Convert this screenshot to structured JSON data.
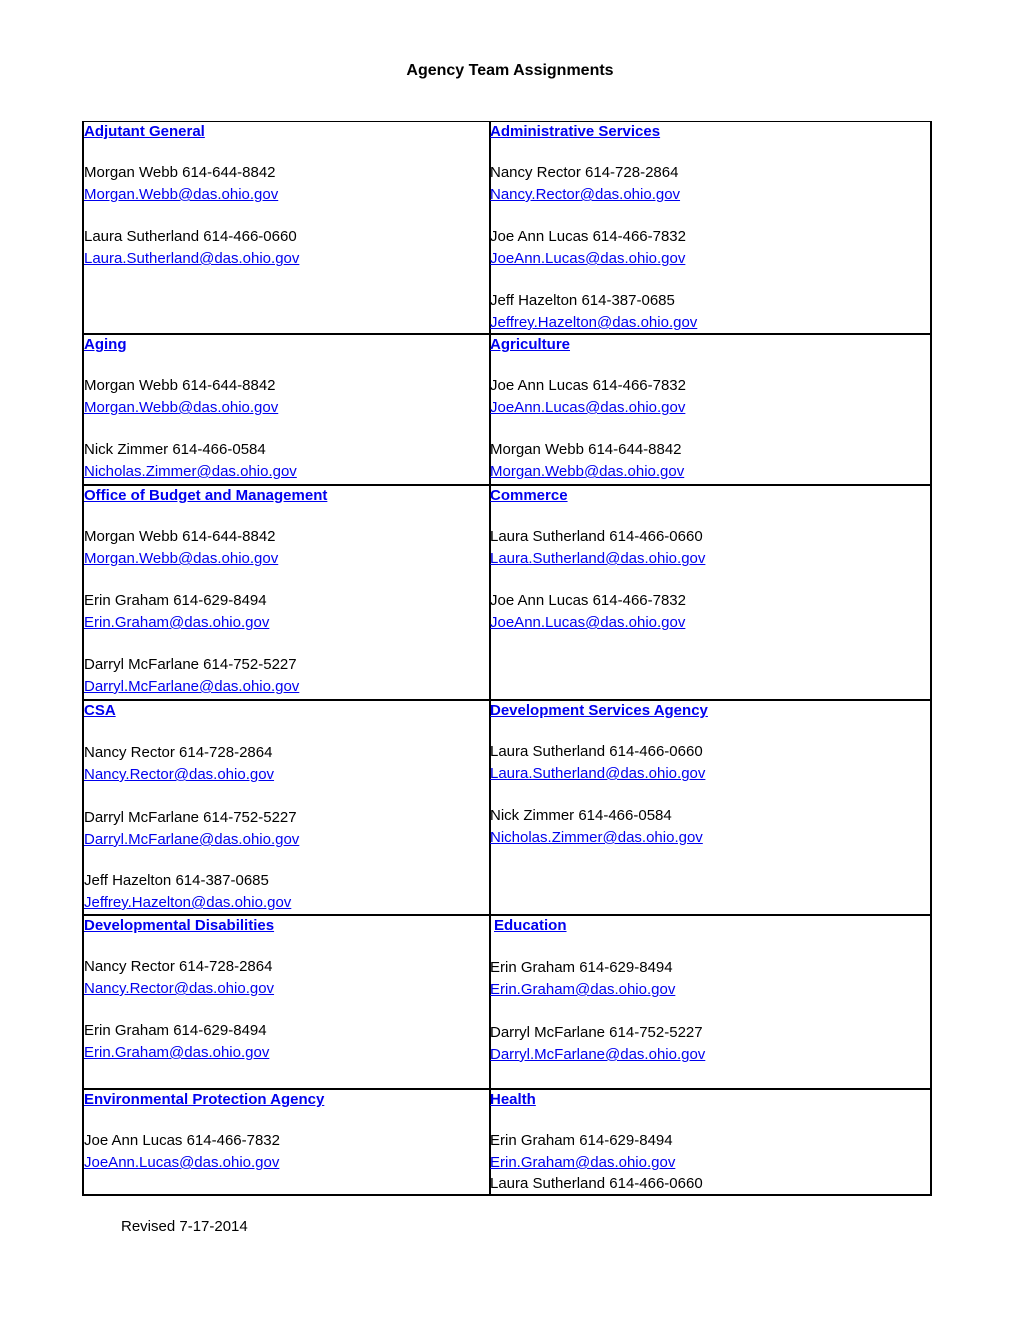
{
  "title": "Agency Team Assignments",
  "footer": "Revised 7-17-2014",
  "rows": [
    {
      "left": {
        "agency": "Adjutant General",
        "contacts": [
          {
            "name_phone": "Morgan Webb 614-644-8842",
            "email": "Morgan.Webb@das.ohio.gov"
          },
          {
            "name_phone": "Laura Sutherland 614-466-0660",
            "email": "Laura.Sutherland@das.ohio.gov"
          }
        ]
      },
      "right": {
        "agency": "Administrative Services",
        "contacts": [
          {
            "name_phone": "Nancy Rector 614-728-2864",
            "email": "Nancy.Rector@das.ohio.gov "
          },
          {
            "name_phone": "Joe Ann Lucas 614-466-7832",
            "email": "JoeAnn.Lucas@das.ohio.gov"
          },
          {
            "name_phone": "Jeff Hazelton 614-387-0685",
            "email": "Jeffrey.Hazelton@das.ohio.gov"
          }
        ]
      }
    },
    {
      "left": {
        "agency": "Aging",
        "contacts": [
          {
            "name_phone": "Morgan Webb 614-644-8842",
            "email": "Morgan.Webb@das.ohio.gov"
          },
          {
            "name_phone": "Nick Zimmer 614-466-0584",
            "email": "Nicholas.Zimmer@das.ohio.gov"
          }
        ]
      },
      "right": {
        "agency": "Agriculture",
        "contacts": [
          {
            "name_phone": "Joe Ann Lucas 614-466-7832",
            "email": "JoeAnn.Lucas@das.ohio.gov"
          },
          {
            "name_phone": "Morgan Webb 614-644-8842",
            "email": "Morgan.Webb@das.ohio.gov"
          }
        ]
      }
    },
    {
      "left": {
        "agency": "Office of Budget and Management",
        "contacts": [
          {
            "name_phone": "Morgan Webb 614-644-8842",
            "email": "Morgan.Webb@das.ohio.gov"
          },
          {
            "name_phone": "Erin Graham 614-629-8494",
            "email": "Erin.Graham@das.ohio.gov"
          },
          {
            "name_phone": "Darryl McFarlane 614-752-5227",
            "email": "Darryl.McFarlane@das.ohio.gov"
          }
        ]
      },
      "right": {
        "agency": "Commerce",
        "contacts": [
          {
            "name_phone": "Laura Sutherland 614-466-0660",
            "email": "Laura.Sutherland@das.ohio.gov"
          },
          {
            "name_phone": "Joe Ann Lucas 614-466-7832",
            "email": "JoeAnn.Lucas@das.ohio.gov"
          }
        ]
      }
    },
    {
      "left": {
        "agency": "CSA",
        "contacts": [
          {
            "name_phone": "Nancy Rector 614-728-2864",
            "email": "Nancy.Rector@das.ohio.gov "
          },
          {
            "name_phone": "Darryl McFarlane 614-752-5227",
            "email": "Darryl.McFarlane@das.ohio.gov"
          },
          {
            "name_phone": "Jeff Hazelton 614-387-0685",
            "email": "Jeffrey.Hazelton@das.ohio.gov"
          }
        ]
      },
      "right": {
        "agency": "Development Services Agency",
        "contacts": [
          {
            "name_phone": "Laura Sutherland 614-466-0660",
            "email": "Laura.Sutherland@das.ohio.gov"
          },
          {
            "name_phone": "Nick Zimmer 614-466-0584",
            "email": "Nicholas.Zimmer@das.ohio.gov"
          }
        ]
      }
    },
    {
      "left": {
        "agency": "Developmental Disabilities",
        "contacts": [
          {
            "name_phone": "Nancy Rector 614-728-2864",
            "email": "Nancy.Rector@das.ohio.gov "
          },
          {
            "name_phone": "Erin Graham 614-629-8494",
            "email": "Erin.Graham@das.ohio.gov"
          }
        ]
      },
      "right": {
        "agency": "Education",
        "contacts": [
          {
            "name_phone": "Erin Graham 614-629-8494",
            "email": "Erin.Graham@das.ohio.gov"
          },
          {
            "name_phone": "Darryl McFarlane 614-752-5227",
            "email": "Darryl.McFarlane@das.ohio.gov"
          }
        ]
      }
    },
    {
      "left": {
        "agency": "Environmental Protection Agency",
        "contacts": [
          {
            "name_phone": "Joe Ann Lucas 614-466-7832",
            "email": "JoeAnn.Lucas@das.ohio.gov"
          }
        ]
      },
      "right": {
        "agency": "Health",
        "contacts": [
          {
            "name_phone": "Erin Graham 614-629-8494",
            "email": "Erin.Graham@das.ohio.gov"
          },
          {
            "name_phone": "Laura Sutherland 614-466-0660",
            "email": null
          }
        ]
      }
    }
  ]
}
